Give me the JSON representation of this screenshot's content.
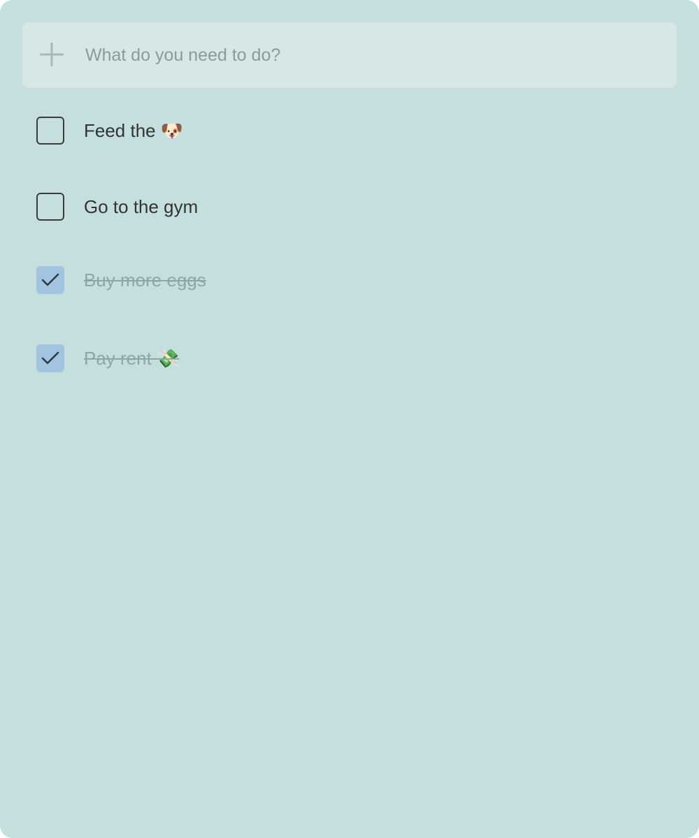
{
  "add_bar": {
    "icon": "plus-icon",
    "placeholder": "What do you need to do?",
    "value": ""
  },
  "todos": [
    {
      "label": "Feed the 🐶",
      "completed": false
    },
    {
      "label": "Go to the gym",
      "completed": false
    },
    {
      "label": "Buy more eggs",
      "completed": true
    },
    {
      "label": "Pay rent 💸",
      "completed": true
    }
  ],
  "colors": {
    "background": "#c5dfdf",
    "input_bar": "#d6e8e6",
    "checked_box": "#a3c4e0",
    "text": "#333333",
    "done_text": "#8fa6a3"
  }
}
